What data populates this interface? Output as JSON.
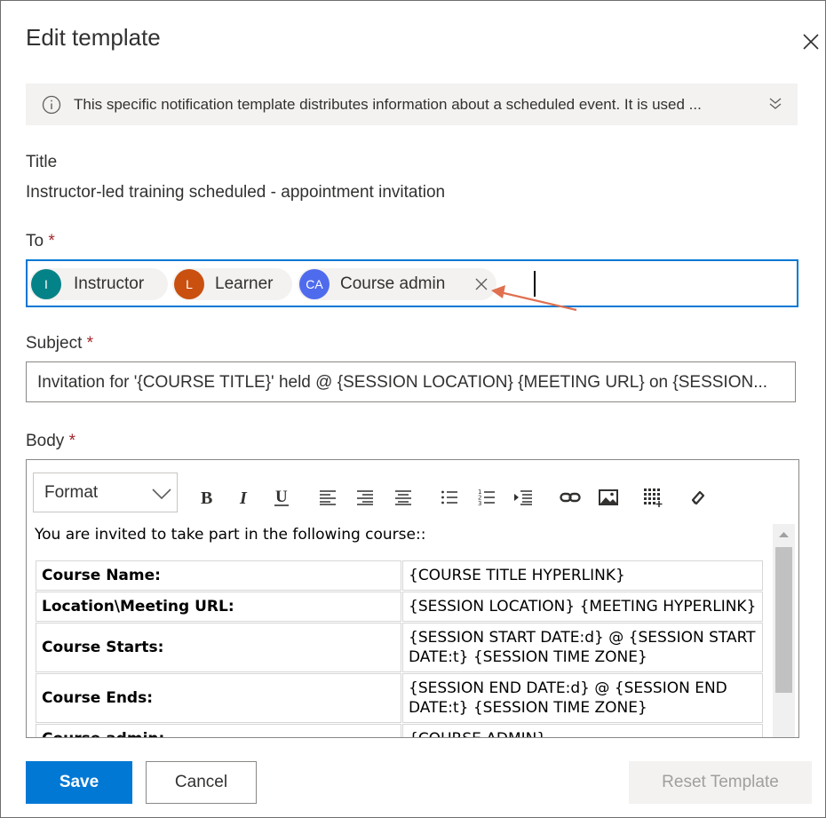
{
  "dialog": {
    "title": "Edit template"
  },
  "info": {
    "text": "This specific notification template distributes information about a scheduled event. It is used ..."
  },
  "title_field": {
    "label": "Title",
    "value": "Instructor-led training scheduled - appointment invitation"
  },
  "to_field": {
    "label": "To",
    "required_mark": "*",
    "recipients": [
      {
        "initials": "I",
        "name": "Instructor",
        "color": "#038387"
      },
      {
        "initials": "L",
        "name": "Learner",
        "color": "#ca5010"
      },
      {
        "initials": "CA",
        "name": "Course admin",
        "color": "#4f6bed"
      }
    ]
  },
  "subject_field": {
    "label": "Subject",
    "required_mark": "*",
    "value": "Invitation for '{COURSE TITLE}' held @ {SESSION LOCATION} {MEETING URL} on {SESSION..."
  },
  "body_field": {
    "label": "Body",
    "required_mark": "*",
    "format_label": "Format",
    "toolbar": [
      "bold-icon",
      "italic-icon",
      "underline-icon",
      "align-left-icon",
      "align-center-icon",
      "align-right-icon",
      "bullet-list-icon",
      "numbered-list-icon",
      "indent-icon",
      "link-icon",
      "image-icon",
      "table-icon",
      "clear-format-icon"
    ],
    "intro": "You are invited to take part in the following course::",
    "rows": [
      {
        "key": "Course Name:",
        "value": "{COURSE TITLE HYPERLINK}"
      },
      {
        "key": "Location\\Meeting URL:",
        "value": "{SESSION LOCATION} {MEETING HYPERLINK}"
      },
      {
        "key": "Course Starts:",
        "value": "{SESSION START DATE:d} @ {SESSION START DATE:t} {SESSION TIME ZONE}"
      },
      {
        "key": "Course Ends:",
        "value": "{SESSION END DATE:d} @ {SESSION END DATE:t} {SESSION TIME ZONE}"
      },
      {
        "key": "Course admin:",
        "value": "{COURSE ADMIN}"
      }
    ]
  },
  "footer": {
    "save_label": "Save",
    "cancel_label": "Cancel",
    "reset_label": "Reset Template"
  },
  "colors": {
    "accent": "#0078d4",
    "required": "#a4262c",
    "annotation_arrow": "#e07050"
  }
}
